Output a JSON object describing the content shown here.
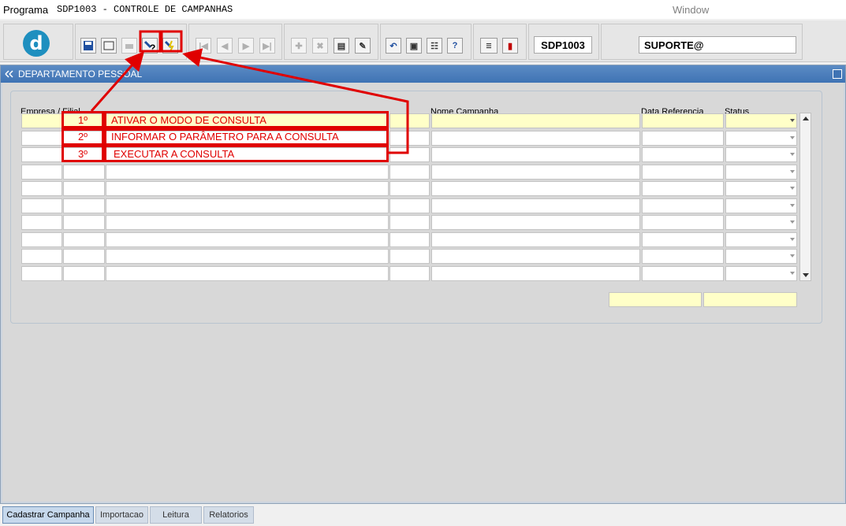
{
  "menubar": {
    "programa": "Programa",
    "title": "SDP1003 - CONTROLE DE CAMPANHAS",
    "window": "Window"
  },
  "toolbar": {
    "module_code": "SDP1003",
    "user": "SUPORTE@"
  },
  "form": {
    "title": "DEPARTAMENTO PESSOAL",
    "headers": {
      "empresa_filial": "Empresa / Filial",
      "nome_campanha": "Nome Campanha",
      "data_referencia": "Data Referencia",
      "status": "Status"
    }
  },
  "annotations": [
    {
      "num": "1º",
      "text": "ATIVAR O MODO DE CONSULTA"
    },
    {
      "num": "2º",
      "text": "INFORMAR O PARÂMETRO PARA A CONSULTA"
    },
    {
      "num": "3º",
      "text": "EXECUTAR A CONSULTA"
    }
  ],
  "tabs": [
    {
      "label": "Cadastrar Campanha",
      "active": true
    },
    {
      "label": "Importacao",
      "active": false
    },
    {
      "label": "Leitura",
      "active": false
    },
    {
      "label": "Relatorios",
      "active": false
    }
  ],
  "colors": {
    "annotation_red": "#e00000",
    "query_field_yellow": "#ffffc8",
    "titlebar_blue": "#4a7fbe"
  },
  "icons": [
    "app-logo-icon",
    "save-icon",
    "window-icon",
    "print-icon",
    "enter-query-icon",
    "execute-query-icon",
    "first-record-icon",
    "previous-record-icon",
    "next-record-icon",
    "last-record-icon",
    "insert-record-icon",
    "delete-record-icon",
    "duplicate-record-icon",
    "clear-record-icon",
    "undo-icon",
    "clipboard-icon",
    "list-values-icon",
    "help-icon",
    "menu-icon",
    "exit-icon"
  ]
}
